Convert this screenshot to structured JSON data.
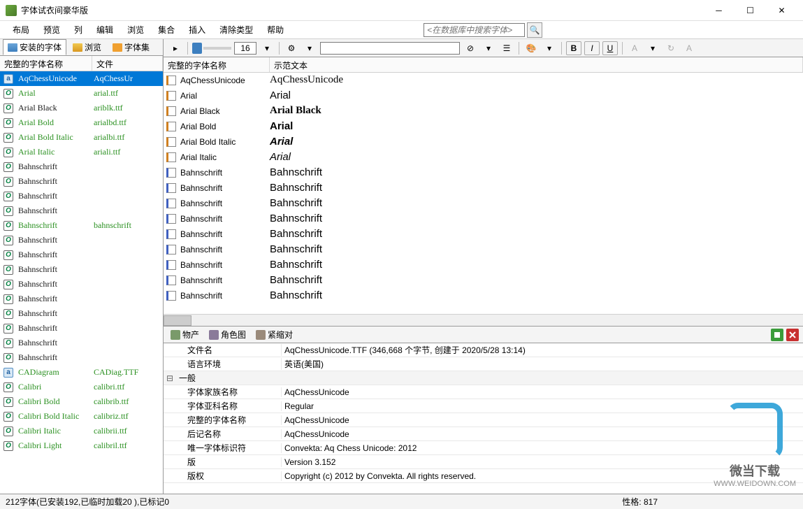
{
  "title": "字体试衣间豪华版",
  "menu": [
    "布局",
    "预览",
    "列",
    "编辑",
    "浏览",
    "集合",
    "插入",
    "清除类型",
    "帮助"
  ],
  "search_placeholder": "<在数据库中搜索字体>",
  "left_tabs": {
    "installed": "安装的字体",
    "browse": "浏览",
    "fontset": "字体集"
  },
  "left_header": {
    "name": "完整的字体名称",
    "file": "文件"
  },
  "fonts": [
    {
      "name": "AqChessUnicode",
      "file": "AqChessUr",
      "icon": "a",
      "selected": true,
      "green": false
    },
    {
      "name": "Arial",
      "file": "arial.ttf",
      "icon": "o",
      "green": true
    },
    {
      "name": "Arial Black",
      "file": "ariblk.ttf",
      "icon": "o",
      "green": false
    },
    {
      "name": "Arial Bold",
      "file": "arialbd.ttf",
      "icon": "o",
      "green": true
    },
    {
      "name": "Arial Bold Italic",
      "file": "arialbi.ttf",
      "icon": "o",
      "green": true
    },
    {
      "name": "Arial Italic",
      "file": "ariali.ttf",
      "icon": "o",
      "green": true
    },
    {
      "name": "Bahnschrift",
      "file": "",
      "icon": "o",
      "green": false
    },
    {
      "name": "Bahnschrift",
      "file": "",
      "icon": "o",
      "green": false
    },
    {
      "name": "Bahnschrift",
      "file": "",
      "icon": "o",
      "green": false
    },
    {
      "name": "Bahnschrift",
      "file": "",
      "icon": "o",
      "green": false
    },
    {
      "name": "Bahnschrift",
      "file": "bahnschrift",
      "icon": "o",
      "green": true
    },
    {
      "name": "Bahnschrift",
      "file": "",
      "icon": "o",
      "green": false
    },
    {
      "name": "Bahnschrift",
      "file": "",
      "icon": "o",
      "green": false
    },
    {
      "name": "Bahnschrift",
      "file": "",
      "icon": "o",
      "green": false
    },
    {
      "name": "Bahnschrift",
      "file": "",
      "icon": "o",
      "green": false
    },
    {
      "name": "Bahnschrift",
      "file": "",
      "icon": "o",
      "green": false
    },
    {
      "name": "Bahnschrift",
      "file": "",
      "icon": "o",
      "green": false
    },
    {
      "name": "Bahnschrift",
      "file": "",
      "icon": "o",
      "green": false
    },
    {
      "name": "Bahnschrift",
      "file": "",
      "icon": "o",
      "green": false
    },
    {
      "name": "Bahnschrift",
      "file": "",
      "icon": "o",
      "green": false
    },
    {
      "name": "CADiagram",
      "file": "CADiag.TTF",
      "icon": "a",
      "green": true
    },
    {
      "name": "Calibri",
      "file": "calibri.ttf",
      "icon": "o",
      "green": true
    },
    {
      "name": "Calibri Bold",
      "file": "calibrib.ttf",
      "icon": "o",
      "green": true
    },
    {
      "name": "Calibri Bold Italic",
      "file": "calibriz.ttf",
      "icon": "o",
      "green": true
    },
    {
      "name": "Calibri Italic",
      "file": "calibrii.ttf",
      "icon": "o",
      "green": true
    },
    {
      "name": "Calibri Light",
      "file": "calibril.ttf",
      "icon": "o",
      "green": true
    }
  ],
  "size_value": "16",
  "preview_header": {
    "name": "完整的字体名称",
    "sample": "示范文本"
  },
  "previews": [
    {
      "chk": "orange",
      "name": "AqChessUnicode",
      "sample": "AqChessUnicode",
      "style": "font-family:serif"
    },
    {
      "chk": "orange",
      "name": "Arial",
      "sample": "Arial",
      "style": "font-family:Arial"
    },
    {
      "chk": "orange",
      "name": "Arial Black",
      "sample": "Arial Black",
      "style": "font-family:'Arial Black';font-weight:900"
    },
    {
      "chk": "orange",
      "name": "Arial Bold",
      "sample": "Arial",
      "style": "font-family:Arial;font-weight:bold"
    },
    {
      "chk": "orange",
      "name": "Arial Bold Italic",
      "sample": "Arial",
      "style": "font-family:Arial;font-weight:bold;font-style:italic"
    },
    {
      "chk": "orange",
      "name": "Arial Italic",
      "sample": "Arial",
      "style": "font-family:Arial;font-style:italic"
    },
    {
      "chk": "blue",
      "name": "Bahnschrift",
      "sample": "Bahnschrift",
      "style": "font-family:Bahnschrift,Arial"
    },
    {
      "chk": "blue",
      "name": "Bahnschrift",
      "sample": "Bahnschrift",
      "style": "font-family:Bahnschrift,Arial"
    },
    {
      "chk": "blue",
      "name": "Bahnschrift",
      "sample": "Bahnschrift",
      "style": "font-family:Bahnschrift,Arial"
    },
    {
      "chk": "blue",
      "name": "Bahnschrift",
      "sample": "Bahnschrift",
      "style": "font-family:Bahnschrift,Arial"
    },
    {
      "chk": "blue",
      "name": "Bahnschrift",
      "sample": "Bahnschrift",
      "style": "font-family:Bahnschrift,Arial"
    },
    {
      "chk": "blue",
      "name": "Bahnschrift",
      "sample": "Bahnschrift",
      "style": "font-family:Bahnschrift,Arial"
    },
    {
      "chk": "blue",
      "name": "Bahnschrift",
      "sample": "Bahnschrift",
      "style": "font-family:Bahnschrift,Arial"
    },
    {
      "chk": "blue",
      "name": "Bahnschrift",
      "sample": "Bahnschrift",
      "style": "font-family:Bahnschrift,Arial"
    },
    {
      "chk": "blue",
      "name": "Bahnschrift",
      "sample": "Bahnschrift",
      "style": "font-family:Bahnschrift,Arial"
    }
  ],
  "details_tabs": {
    "prop": "物产",
    "charmap": "角色图",
    "kerning": "紧缩对"
  },
  "properties": [
    {
      "type": "row",
      "key": "文件名",
      "val": "AqChessUnicode.TTF (346,668 个字节, 创建于 2020/5/28 13:14)"
    },
    {
      "type": "row",
      "key": "语言环境",
      "val": "英语(美国)"
    },
    {
      "type": "group",
      "key": "一般"
    },
    {
      "type": "row",
      "key": "字体家族名称",
      "val": "AqChessUnicode"
    },
    {
      "type": "row",
      "key": "字体亚科名称",
      "val": "Regular"
    },
    {
      "type": "row",
      "key": "完整的字体名称",
      "val": "AqChessUnicode"
    },
    {
      "type": "row",
      "key": "后记名称",
      "val": "AqChessUnicode"
    },
    {
      "type": "row",
      "key": "唯一字体标识符",
      "val": "Convekta: Aq Chess Unicode: 2012"
    },
    {
      "type": "row",
      "key": "版",
      "val": "Version 3.152"
    },
    {
      "type": "row",
      "key": "版权",
      "val": "Copyright (c) 2012 by Convekta. All rights reserved."
    }
  ],
  "status": {
    "left": "212字体(已安装192,已临时加载20 ),已标记0",
    "right": "性格: 817"
  },
  "watermark": {
    "text": "微当下载",
    "url": "WWW.WEIDOWN.COM"
  }
}
